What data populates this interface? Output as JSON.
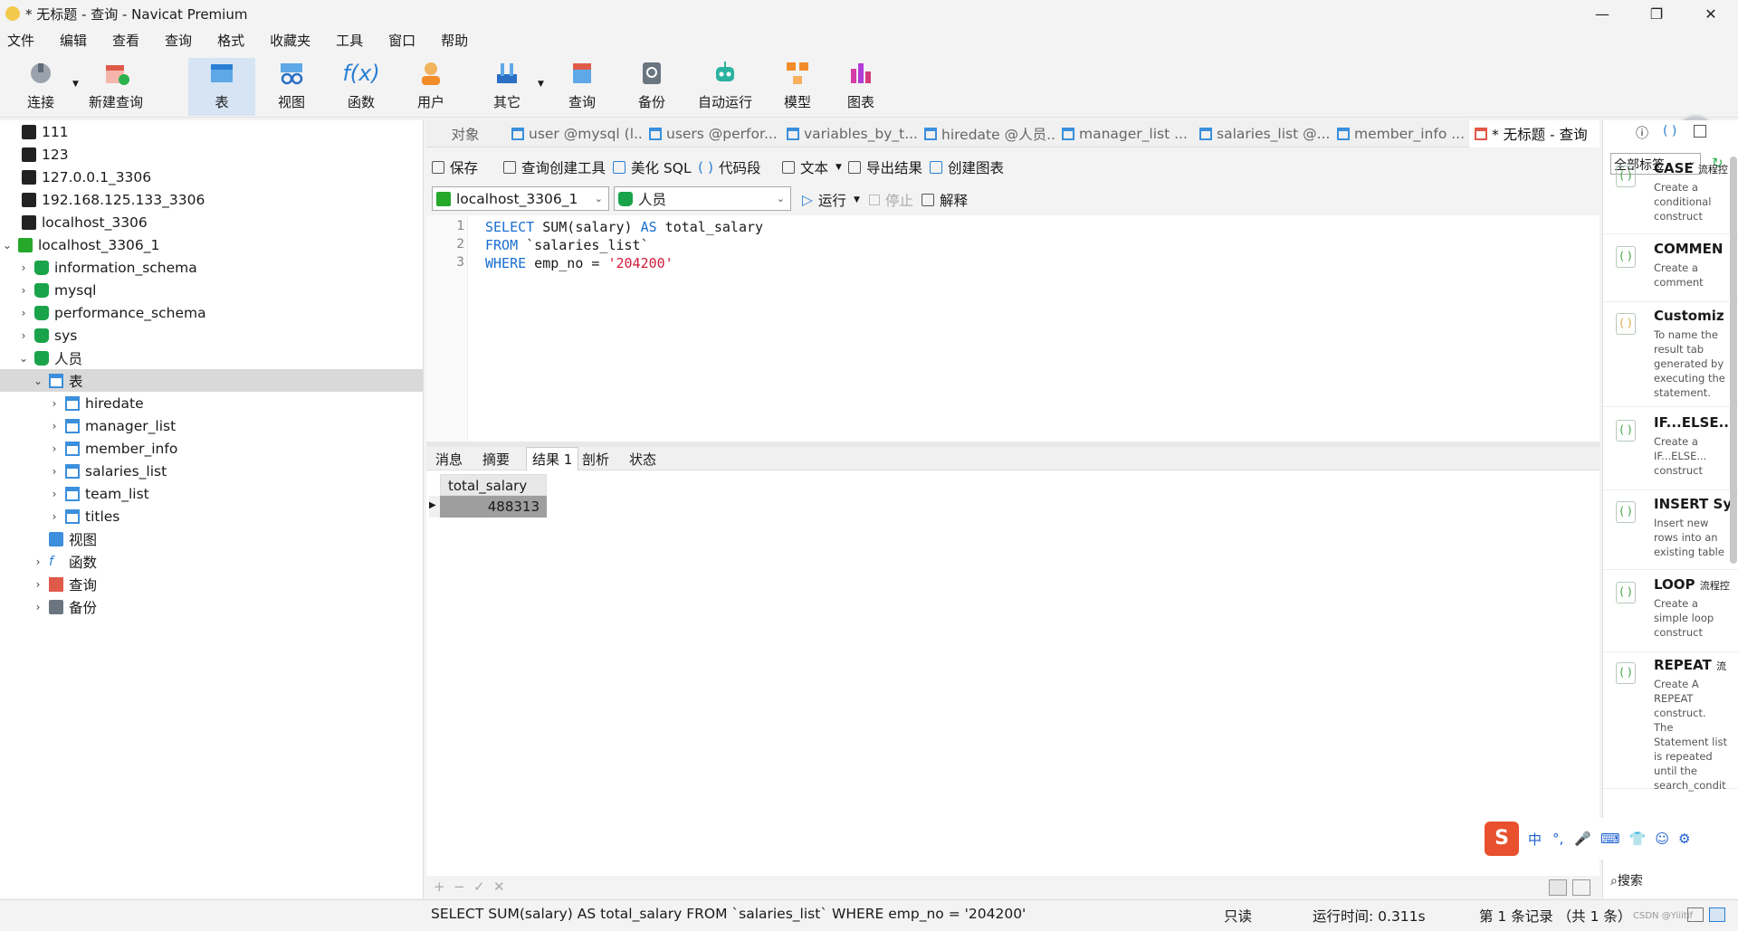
{
  "window": {
    "title": "* 无标题 - 查询 - Navicat Premium",
    "minimize": "—",
    "restore": "❐",
    "close": "✕"
  },
  "menu": [
    "文件",
    "编辑",
    "查看",
    "查询",
    "格式",
    "收藏夹",
    "工具",
    "窗口",
    "帮助"
  ],
  "toolbar": {
    "connect": "连接",
    "new_query": "新建查询",
    "table": "表",
    "view": "视图",
    "function": "函数",
    "user": "用户",
    "other": "其它",
    "query": "查询",
    "backup": "备份",
    "automation": "自动运行",
    "model": "模型",
    "chart": "图表"
  },
  "tree": {
    "connections": [
      "111",
      "123",
      "127.0.0.1_3306",
      "192.168.125.133_3306",
      "localhost_3306"
    ],
    "active_connection": "localhost_3306_1",
    "databases": [
      "information_schema",
      "mysql",
      "performance_schema",
      "sys"
    ],
    "active_db": "人员",
    "tables_folder": "表",
    "tables": [
      "hiredate",
      "manager_list",
      "member_info",
      "salaries_list",
      "team_list",
      "titles"
    ],
    "views": "视图",
    "functions": "函数",
    "queries": "查询",
    "backups": "备份"
  },
  "tabs": {
    "objects": "对象",
    "items": [
      "user @mysql (l...",
      "users @perfor...",
      "variables_by_t...",
      "hiredate @人员...",
      "manager_list ...",
      "salaries_list @...",
      "member_info ..."
    ],
    "active": "* 无标题 - 查询"
  },
  "query_toolbar": {
    "save": "保存",
    "builder": "查询创建工具",
    "beautify": "美化 SQL",
    "snippet": "代码段",
    "text": "文本",
    "export": "导出结果",
    "create_chart": "创建图表",
    "connection": "localhost_3306_1",
    "database": "人员",
    "run": "运行",
    "stop": "停止",
    "explain": "解释"
  },
  "editor": {
    "line_numbers": [
      "1",
      "2",
      "3"
    ],
    "l1_kw1": "SELECT",
    "l1_rest": " SUM(salary) ",
    "l1_kw2": "AS",
    "l1_tail": " total_salary",
    "l2_kw": "FROM",
    "l2_rest": " `salaries_list`",
    "l3_kw": "WHERE",
    "l3_rest": " emp_no = ",
    "l3_str": "'204200'"
  },
  "result_tabs": [
    "消息",
    "摘要",
    "结果 1",
    "剖析",
    "状态"
  ],
  "result": {
    "column": "total_salary",
    "value": "488313"
  },
  "grid_footer": {
    "add": "+",
    "remove": "−",
    "apply": "✓",
    "cancel": "✕"
  },
  "right_panel": {
    "filter": "全部标签",
    "search": "搜索",
    "snippets": [
      {
        "title": "CASE",
        "tag": "流程控",
        "desc": "Create a conditional construct"
      },
      {
        "title": "COMMEN",
        "tag": "",
        "desc": "Create a comment"
      },
      {
        "title": "Customiz",
        "tag": "",
        "desc": "To name the result tab generated by executing the statement."
      },
      {
        "title": "IF...ELSE...",
        "tag": "",
        "desc": "Create a IF...ELSE... construct"
      },
      {
        "title": "INSERT Sy",
        "tag": "",
        "desc": "Insert new rows into an existing table"
      },
      {
        "title": "LOOP",
        "tag": "流程控",
        "desc": "Create a simple loop construct"
      },
      {
        "title": "REPEAT",
        "tag": "流",
        "desc": "Create A REPEAT construct. The Statement list is repeated until the search_condit"
      }
    ]
  },
  "statusbar": {
    "sql": "SELECT SUM(salary) AS total_salary FROM `salaries_list` WHERE emp_no = '204200'",
    "readonly": "只读",
    "runtime": "运行时间: 0.311s",
    "records": "第 1 条记录 （共 1 条）",
    "watermark": "CSDN @Yiiitif"
  },
  "ime": {
    "lang": "中"
  }
}
